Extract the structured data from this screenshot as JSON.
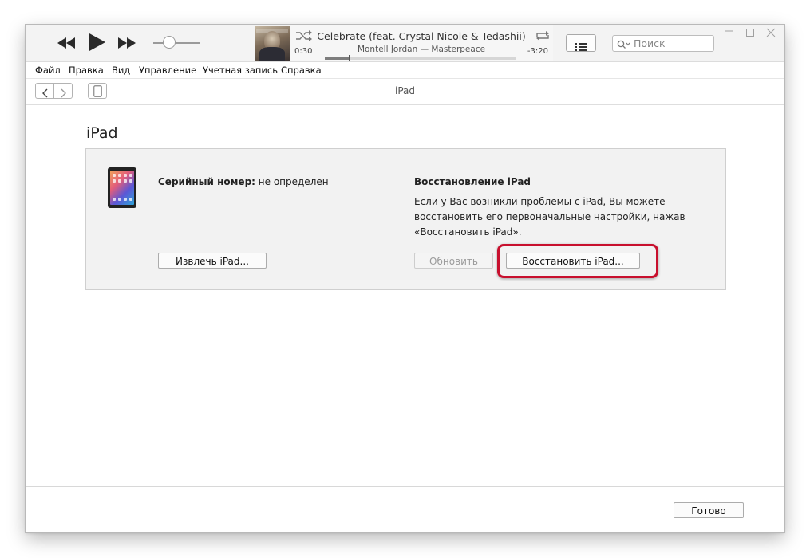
{
  "player": {
    "song_title": "Celebrate (feat. Crystal Nicole & Tedashii)",
    "song_artist": "Montell Jordan — Masterpeace",
    "time_elapsed": "0:30",
    "time_remaining": "-3:20",
    "progress": 0.13,
    "volume": 0.35
  },
  "search": {
    "placeholder": "Поиск"
  },
  "menu": {
    "items": [
      "Файл",
      "Правка",
      "Вид",
      "Управление",
      "Учетная запись",
      "Справка"
    ]
  },
  "nav": {
    "title": "iPad"
  },
  "content": {
    "page_title": "iPad",
    "serial_label": "Серийный номер:",
    "serial_value": "не определен",
    "restore_title": "Восстановление iPad",
    "restore_desc": "Если у Вас возникли проблемы с iPad, Вы можете восстановить его первоначальные настройки, нажав «Восстановить iPad».",
    "eject_label": "Извлечь iPad...",
    "update_label": "Обновить",
    "restore_label": "Восстановить iPad..."
  },
  "footer": {
    "done_label": "Готово"
  },
  "colors": {
    "highlight": "#c8102e"
  }
}
